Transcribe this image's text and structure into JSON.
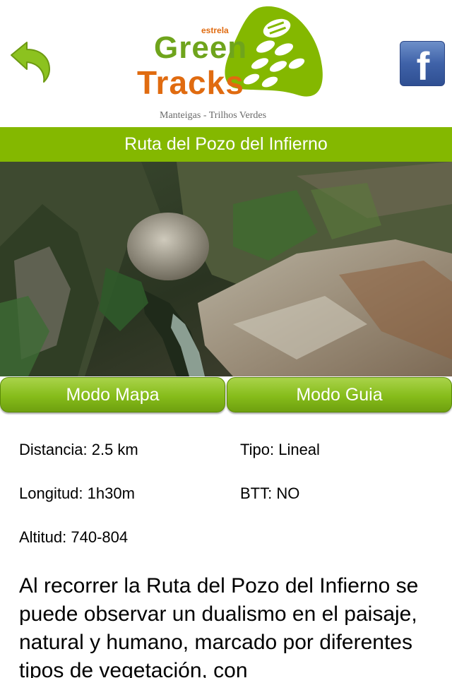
{
  "header": {
    "logo": {
      "small_word": "estrela",
      "line1": "Green",
      "line2": "Tracks",
      "subtitle": "Manteigas - Trilhos Verdes"
    },
    "back_icon": "back-arrow-icon",
    "facebook_icon": "facebook-icon",
    "facebook_letter": "f"
  },
  "title_bar": {
    "title": "Ruta del Pozo del Infierno"
  },
  "buttons": {
    "map_mode": "Modo Mapa",
    "guide_mode": "Modo Guia"
  },
  "details": {
    "distance": "Distancia: 2.5 km",
    "type": "Tipo: Lineal",
    "duration": "Longitud: 1h30m",
    "btt": "BTT: NO",
    "altitude": "Altitud: 740-804"
  },
  "description": "Al recorrer la Ruta del Pozo del Infierno se puede observar un dualismo en el paisaje, natural y humano, marcado por diferentes tipos de vegetación, con",
  "colors": {
    "accent_green": "#84b800",
    "logo_orange": "#e06b10",
    "logo_green": "#6fa41c",
    "facebook_blue": "#3f62a8"
  }
}
